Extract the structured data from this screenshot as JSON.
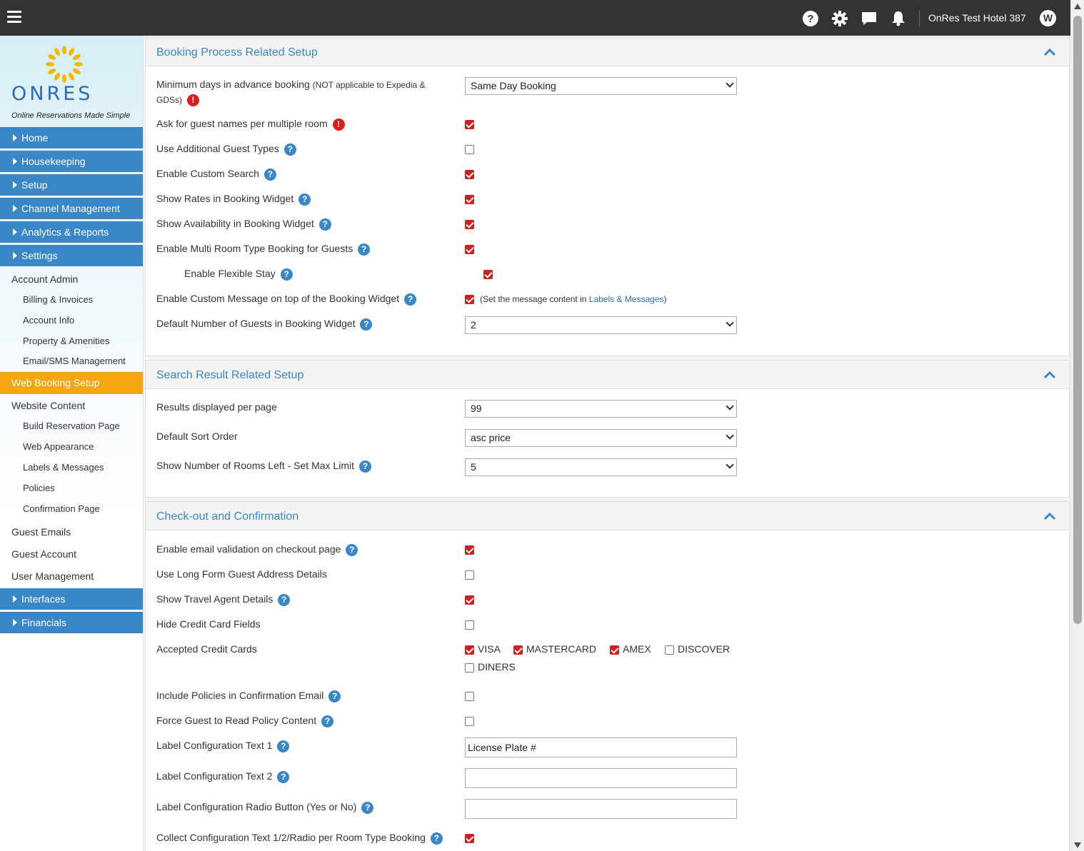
{
  "topbar": {
    "hotel_name": "OnRes Test Hotel 387",
    "user_initial": "W",
    "icons": [
      "help-icon",
      "gear-icon",
      "chat-icon",
      "bell-icon"
    ]
  },
  "logo": {
    "brand": "ONRES",
    "tagline": "Online Reservations Made Simple"
  },
  "sidebar": {
    "blue_top": [
      "Home",
      "Housekeeping",
      "Setup",
      "Channel Management",
      "Analytics & Reports",
      "Settings"
    ],
    "account_admin": "Account Admin",
    "account_sub": [
      "Billing & Invoices",
      "Account Info",
      "Property & Amenities",
      "Email/SMS Management"
    ],
    "active": "Web Booking Setup",
    "website_content": "Website Content",
    "website_sub": [
      "Build Reservation Page",
      "Web Appearance",
      "Labels & Messages",
      "Policies",
      "Confirmation Page"
    ],
    "plain_bottom": [
      "Guest Emails",
      "Guest Account",
      "User Management"
    ],
    "blue_bottom": [
      "Interfaces",
      "Financials"
    ]
  },
  "booking": {
    "title": "Booking Process Related Setup",
    "min_days_label": "Minimum days in advance booking",
    "min_days_note": "(NOT applicable to Expedia &",
    "min_days_note2": "GDSs)",
    "min_days_value": "Same Day Booking",
    "guest_names_label": "Ask for guest names per multiple room",
    "additional_types_label": "Use Additional Guest Types",
    "custom_search_label": "Enable Custom Search",
    "show_rates_label": "Show Rates in Booking Widget",
    "show_avail_label": "Show Availability in Booking Widget",
    "multi_room_label": "Enable Multi Room Type Booking for Guests",
    "flexible_label": "Enable Flexible Stay",
    "custom_msg_label": "Enable Custom Message on top of the Booking Widget",
    "custom_msg_note": "(Set the message content in",
    "custom_msg_link": "Labels & Messages",
    "custom_msg_close": ")",
    "default_guests_label": "Default Number of Guests in Booking Widget",
    "default_guests_value": "2"
  },
  "search": {
    "title": "Search Result Related Setup",
    "per_page_label": "Results displayed per page",
    "per_page_value": "99",
    "sort_label": "Default Sort Order",
    "sort_value": "asc price",
    "rooms_left_label": "Show Number of Rooms Left - Set Max Limit",
    "rooms_left_value": "5"
  },
  "checkout": {
    "title": "Check-out and Confirmation",
    "email_val_label": "Enable email validation on checkout page",
    "long_form_label": "Use Long Form Guest Address Details",
    "travel_agent_label": "Show Travel Agent Details",
    "hide_cc_label": "Hide Credit Card Fields",
    "accepted_cc_label": "Accepted Credit Cards",
    "cards": [
      "VISA",
      "MASTERCARD",
      "AMEX",
      "DISCOVER",
      "DINERS"
    ],
    "include_policies_label": "Include Policies in Confirmation Email",
    "force_read_label": "Force Guest to Read Policy Content",
    "label1_label": "Label Configuration Text 1",
    "label1_value": "License Plate #",
    "label2_label": "Label Configuration Text 2",
    "label2_value": "",
    "radio_label": "Label Configuration Radio Button (Yes or No)",
    "radio_value": "",
    "collect_label": "Collect Configuration Text 1/2/Radio per Room Type Booking"
  },
  "colors": {
    "accent_blue": "#3a87c8",
    "active_orange": "#f7a613",
    "checkbox_red": "#d0201e",
    "topbar": "#333333"
  }
}
